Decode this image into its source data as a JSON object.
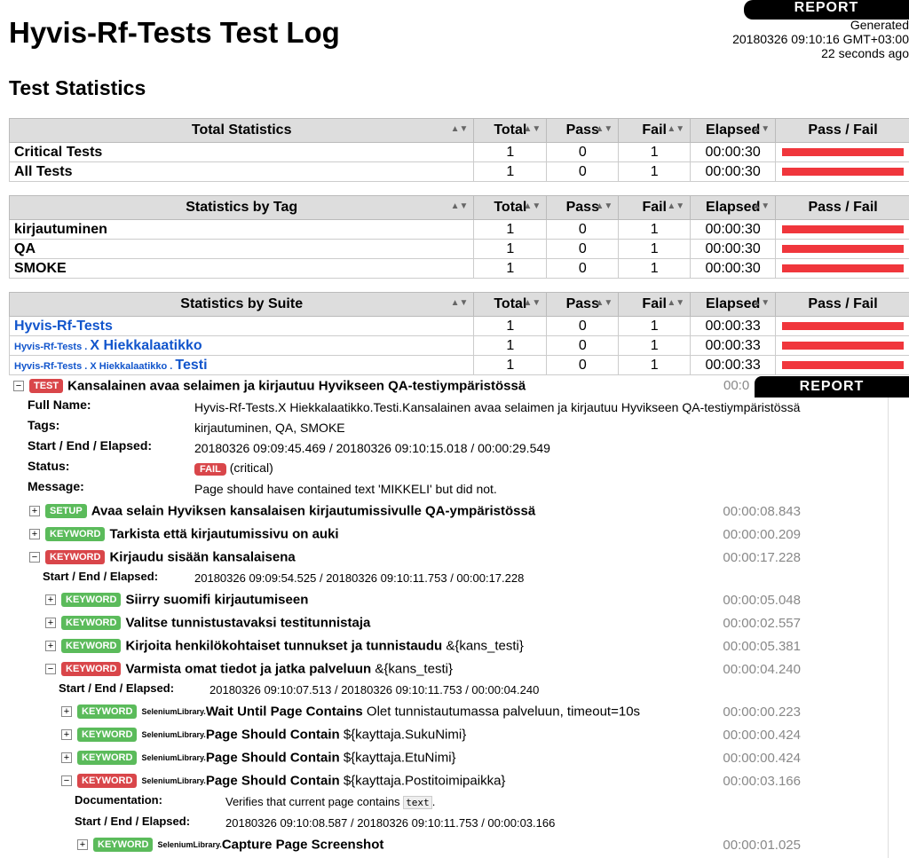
{
  "header": {
    "report_label": "REPORT",
    "title": "Hyvis-Rf-Tests Test Log",
    "generated_label": "Generated",
    "generated_time": "20180326 09:10:16 GMT+03:00",
    "generated_ago": "22 seconds ago"
  },
  "section_title": "Test Statistics",
  "columns": [
    "Total",
    "Pass",
    "Fail",
    "Elapsed",
    "Pass / Fail"
  ],
  "total_stats": {
    "heading": "Total Statistics",
    "rows": [
      {
        "name": "Critical Tests",
        "total": "1",
        "pass": "0",
        "fail": "1",
        "elapsed": "00:00:30",
        "pass_fraction": 0
      },
      {
        "name": "All Tests",
        "total": "1",
        "pass": "0",
        "fail": "1",
        "elapsed": "00:00:30",
        "pass_fraction": 0
      }
    ]
  },
  "tag_stats": {
    "heading": "Statistics by Tag",
    "rows": [
      {
        "name": "kirjautuminen",
        "total": "1",
        "pass": "0",
        "fail": "1",
        "elapsed": "00:00:30",
        "pass_fraction": 0
      },
      {
        "name": "QA",
        "total": "1",
        "pass": "0",
        "fail": "1",
        "elapsed": "00:00:30",
        "pass_fraction": 0
      },
      {
        "name": "SMOKE",
        "total": "1",
        "pass": "0",
        "fail": "1",
        "elapsed": "00:00:30",
        "pass_fraction": 0
      }
    ]
  },
  "suite_stats": {
    "heading": "Statistics by Suite",
    "rows": [
      {
        "parent": "",
        "name": "Hyvis-Rf-Tests",
        "total": "1",
        "pass": "0",
        "fail": "1",
        "elapsed": "00:00:33",
        "pass_fraction": 0
      },
      {
        "parent": "Hyvis-Rf-Tests . ",
        "name": "X Hiekkalaatikko",
        "total": "1",
        "pass": "0",
        "fail": "1",
        "elapsed": "00:00:33",
        "pass_fraction": 0
      },
      {
        "parent": "Hyvis-Rf-Tests . X Hiekkalaatikko . ",
        "name": "Testi",
        "total": "1",
        "pass": "0",
        "fail": "1",
        "elapsed": "00:00:33",
        "pass_fraction": 0
      }
    ]
  },
  "test": {
    "label": "TEST",
    "name": "Kansalainen avaa selaimen ja kirjautuu Hyvikseen QA-testiympäristössä",
    "elapsed_partial": "00:0",
    "full_name_label": "Full Name:",
    "full_name": "Hyvis-Rf-Tests.X Hiekkalaatikko.Testi.Kansalainen avaa selaimen ja kirjautuu Hyvikseen QA-testiympäristössä",
    "tags_label": "Tags:",
    "tags": "kirjautuminen, QA, SMOKE",
    "times_label": "Start / End / Elapsed:",
    "times": "20180326 09:09:45.469 / 20180326 09:10:15.018 / 00:00:29.549",
    "status_label": "Status:",
    "status": "FAIL",
    "status_note": "(critical)",
    "message_label": "Message:",
    "message": "Page should have contained text 'MIKKELI' but did not."
  },
  "keywords": [
    {
      "toggle": "+",
      "label": "SETUP",
      "color": "green",
      "lib": "",
      "name": "Avaa selain Hyviksen kansalaisen kirjautumissivulle QA-ympäristössä",
      "args": "",
      "elapsed": "00:00:08.843"
    },
    {
      "toggle": "+",
      "label": "KEYWORD",
      "color": "green",
      "lib": "",
      "name": "Tarkista että kirjautumissivu on auki",
      "args": "",
      "elapsed": "00:00:00.209"
    },
    {
      "toggle": "−",
      "label": "KEYWORD",
      "color": "red",
      "lib": "",
      "name": "Kirjaudu sisään kansalaisena",
      "args": "",
      "elapsed": "00:00:17.228"
    },
    {
      "toggle": "+",
      "label": "KEYWORD",
      "color": "green",
      "lib": "",
      "name": "Siirry suomifi kirjautumiseen",
      "args": "",
      "elapsed": "00:00:05.048"
    },
    {
      "toggle": "+",
      "label": "KEYWORD",
      "color": "green",
      "lib": "",
      "name": "Valitse tunnistustavaksi testitunnistaja",
      "args": "",
      "elapsed": "00:00:02.557"
    },
    {
      "toggle": "+",
      "label": "KEYWORD",
      "color": "green",
      "lib": "",
      "name": "Kirjoita henkilökohtaiset tunnukset ja tunnistaudu",
      "args": " &{kans_testi}",
      "elapsed": "00:00:05.381"
    },
    {
      "toggle": "−",
      "label": "KEYWORD",
      "color": "red",
      "lib": "",
      "name": "Varmista omat tiedot ja jatka palveluun",
      "args": " &{kans_testi}",
      "elapsed": "00:00:04.240"
    },
    {
      "toggle": "+",
      "label": "KEYWORD",
      "color": "green",
      "lib": "SeleniumLibrary.",
      "name": "Wait Until Page Contains",
      "args": " Olet tunnistautumassa palveluun, timeout=10s",
      "elapsed": "00:00:00.223"
    },
    {
      "toggle": "+",
      "label": "KEYWORD",
      "color": "green",
      "lib": "SeleniumLibrary.",
      "name": "Page Should Contain",
      "args": " ${kayttaja.SukuNimi}",
      "elapsed": "00:00:00.424"
    },
    {
      "toggle": "+",
      "label": "KEYWORD",
      "color": "green",
      "lib": "SeleniumLibrary.",
      "name": "Page Should Contain",
      "args": " ${kayttaja.EtuNimi}",
      "elapsed": "00:00:00.424"
    },
    {
      "toggle": "−",
      "label": "KEYWORD",
      "color": "red",
      "lib": "SeleniumLibrary.",
      "name": "Page Should Contain",
      "args": " ${kayttaja.Postitoimipaikka}",
      "elapsed": "00:00:03.166"
    },
    {
      "toggle": "+",
      "label": "KEYWORD",
      "color": "green",
      "lib": "SeleniumLibrary.",
      "name": "Capture Page Screenshot",
      "args": "",
      "elapsed": "00:00:01.025"
    }
  ],
  "kw_details": {
    "login_times_label": "Start / End / Elapsed:",
    "login_times": "20180326 09:09:54.525 / 20180326 09:10:11.753 / 00:00:17.228",
    "verify_times_label": "Start / End / Elapsed:",
    "verify_times": "20180326 09:10:07.513 / 20180326 09:10:11.753 / 00:00:04.240",
    "doc_label": "Documentation:",
    "doc_text_pre": "Verifies that current page contains ",
    "doc_code": "text",
    "doc_text_post": ".",
    "psc_times_label": "Start / End / Elapsed:",
    "psc_times": "20180326 09:10:08.587 / 20180326 09:10:11.753 / 00:00:03.166"
  },
  "colors": {
    "fail_bar": "#f0363c",
    "pass_label": "#5bbb5b",
    "fail_label": "#d9464a",
    "link": "#1155cc"
  }
}
